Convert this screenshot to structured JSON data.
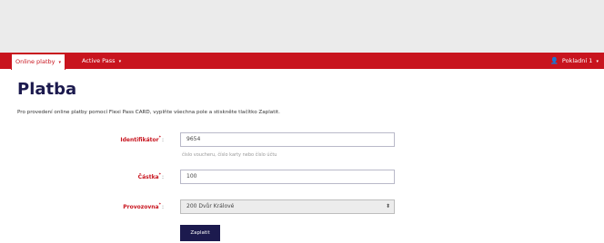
{
  "nav": {
    "online_payments": "Online platby",
    "active_pass": "Active Pass",
    "user": "Pokladní 1"
  },
  "page": {
    "title": "Platba",
    "intro": "Pro provedení online platby pomocí Flexi Pass CARD, vyplňte všechna pole a stiskněte tlačítko Zaplatit."
  },
  "form": {
    "identifier": {
      "label": "Identifikátor",
      "value": "9654",
      "help": "číslo voucheru, číslo karty nebo číslo účtu"
    },
    "amount": {
      "label": "Částka",
      "value": "100"
    },
    "venue": {
      "label": "Provozovna",
      "selected": "200 Dvůr Králové"
    },
    "submit_label": "Zaplatit"
  },
  "icons": {
    "user": "user-icon",
    "caret": "chevron-down-icon",
    "select_arrow": "select-arrows-icon"
  },
  "colors": {
    "brand_red": "#c8141e",
    "navy": "#1c1a4e"
  }
}
